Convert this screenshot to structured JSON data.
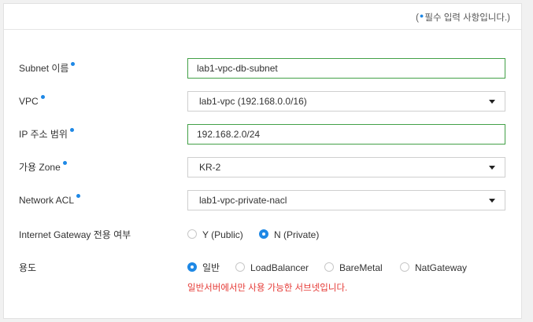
{
  "header": {
    "note_prefix": "(",
    "note_text": "필수 입력 사항입니다.)"
  },
  "form": {
    "subnet_name": {
      "label": "Subnet 이름",
      "value": "lab1-vpc-db-subnet"
    },
    "vpc": {
      "label": "VPC",
      "selected": "lab1-vpc (192.168.0.0/16)"
    },
    "ip_range": {
      "label": "IP 주소 범위",
      "value": "192.168.2.0/24"
    },
    "zone": {
      "label": "가용 Zone",
      "selected": "KR-2"
    },
    "network_acl": {
      "label": "Network ACL",
      "selected": "lab1-vpc-private-nacl"
    },
    "igw": {
      "label": "Internet Gateway 전용 여부",
      "options": [
        {
          "label": "Y (Public)",
          "selected": false
        },
        {
          "label": "N (Private)",
          "selected": true
        }
      ]
    },
    "usage": {
      "label": "용도",
      "options": [
        {
          "label": "일반",
          "selected": true
        },
        {
          "label": "LoadBalancer",
          "selected": false
        },
        {
          "label": "BareMetal",
          "selected": false
        },
        {
          "label": "NatGateway",
          "selected": false
        }
      ],
      "help": "일반서버에서만 사용 가능한 서브넷입니다."
    }
  },
  "colors": {
    "accent": "#1e88e5",
    "valid_border": "#43a047",
    "help_text": "#e53935"
  }
}
